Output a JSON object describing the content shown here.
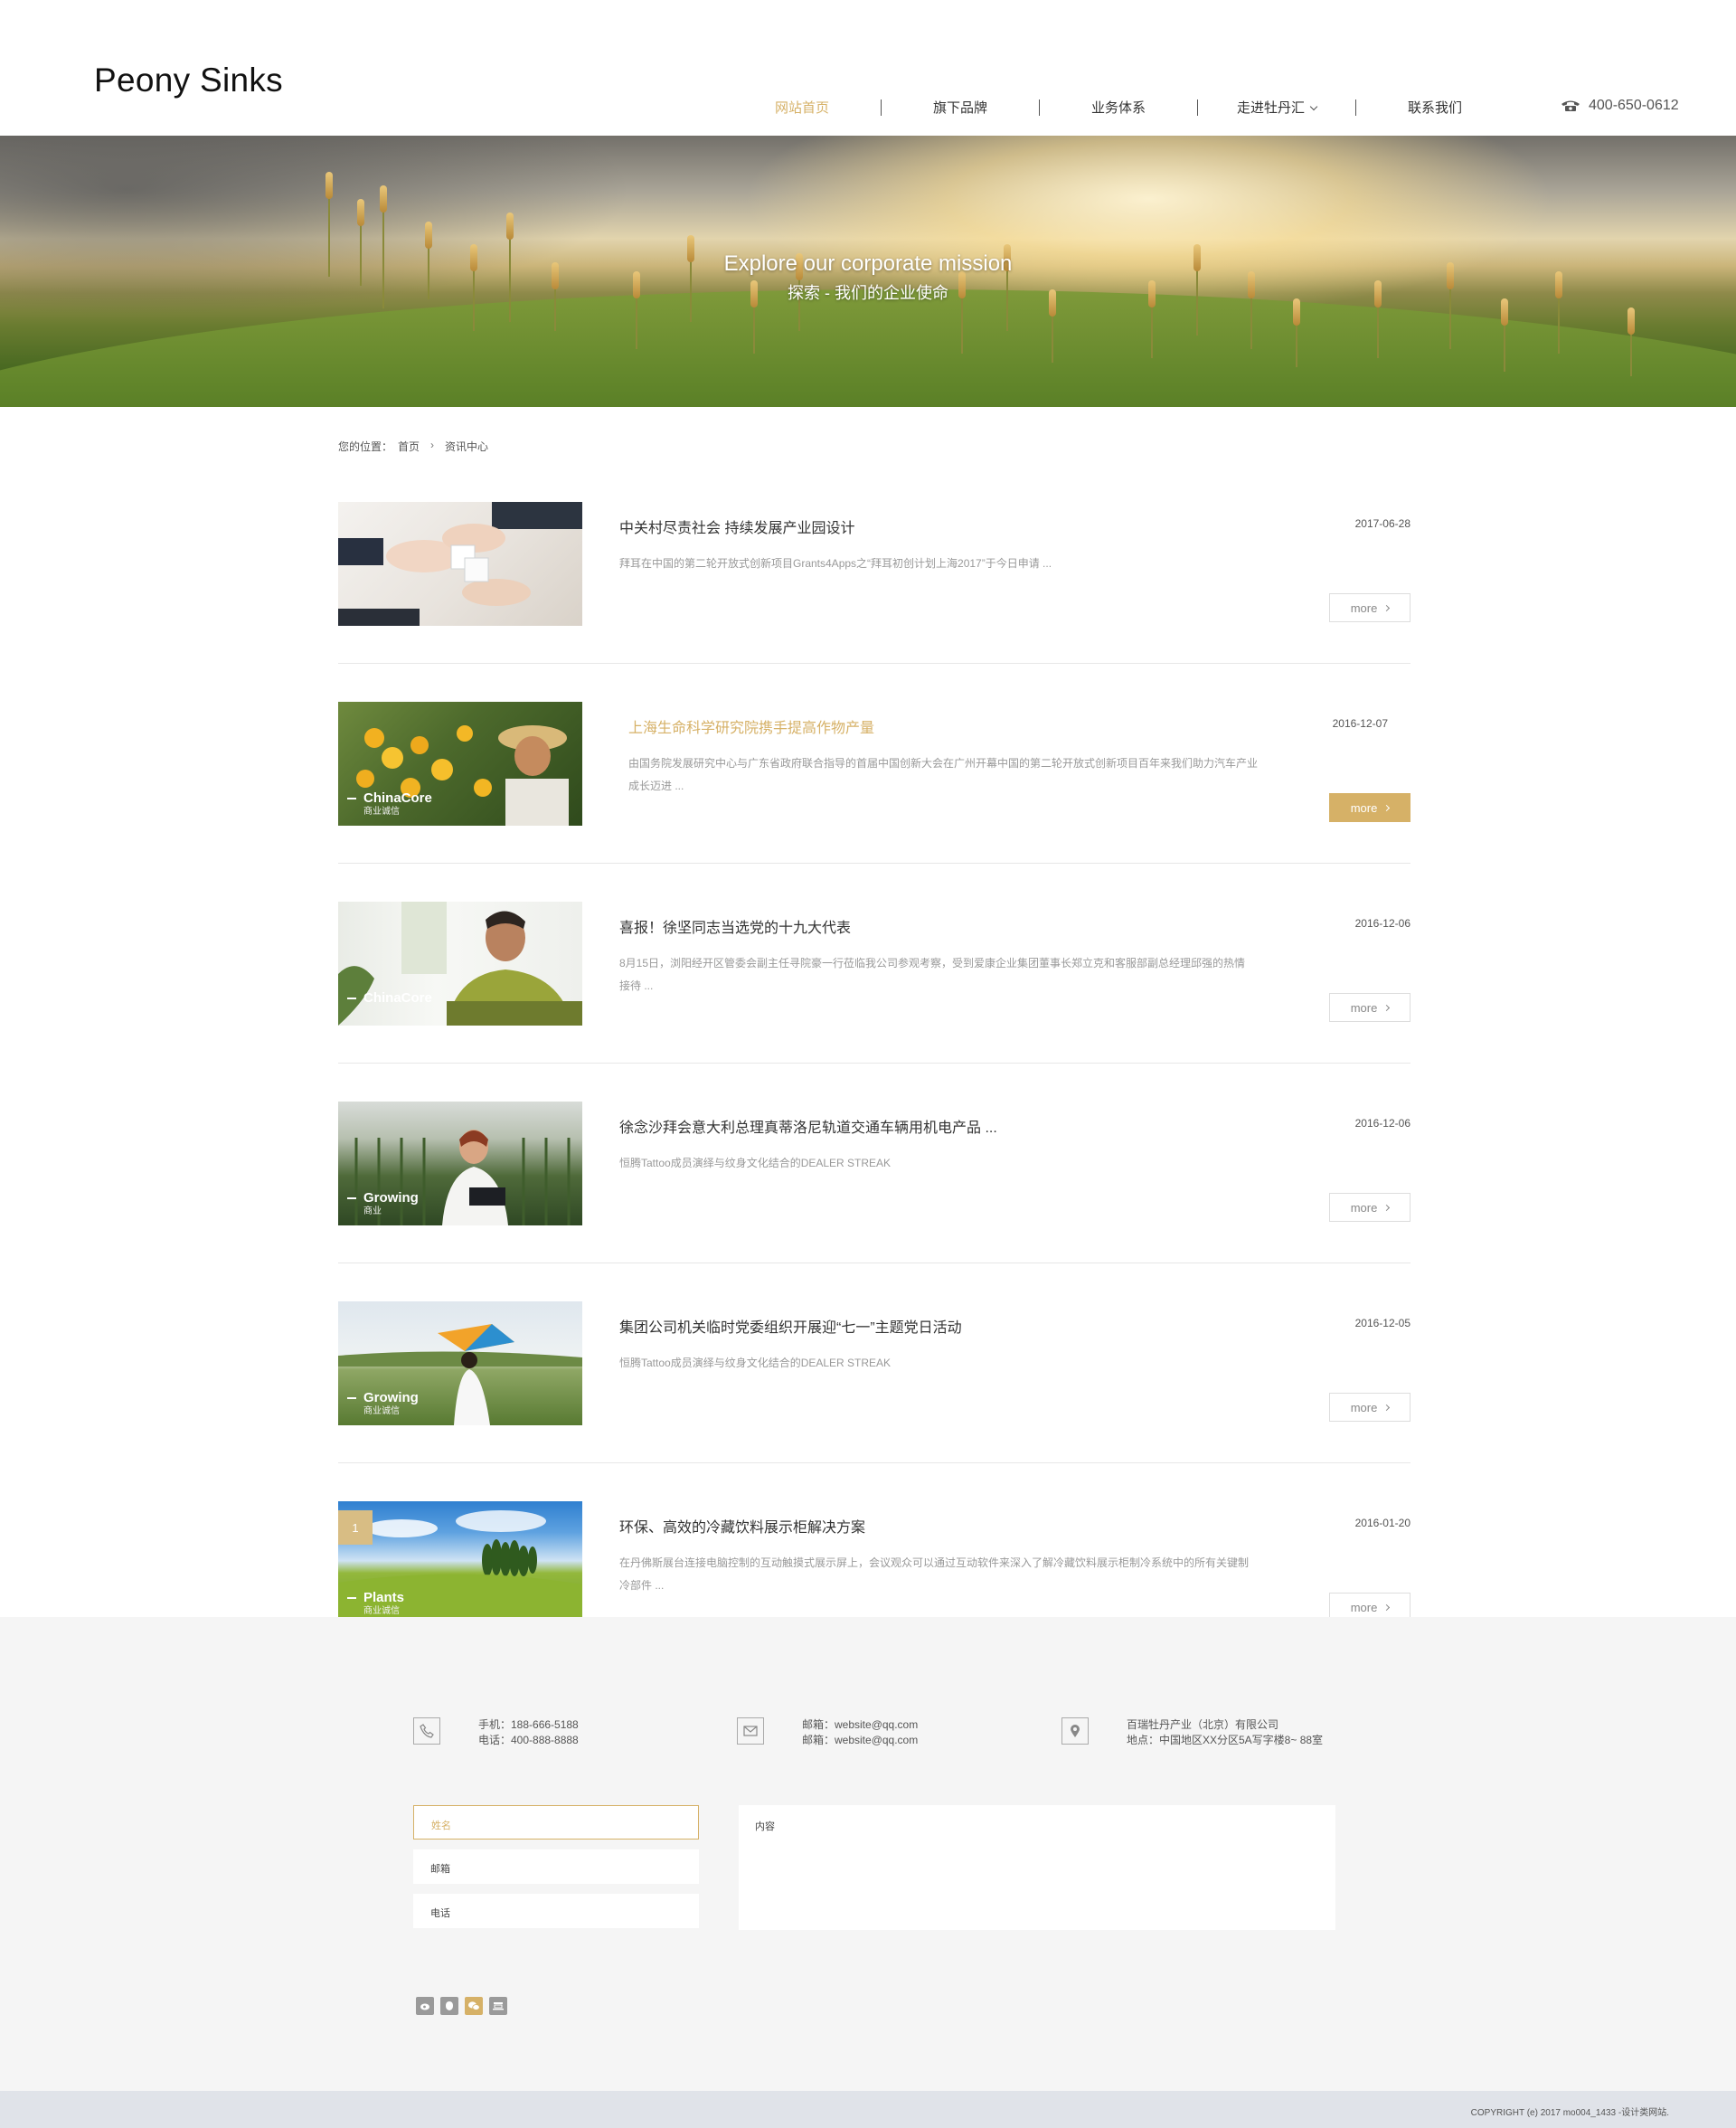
{
  "header": {
    "logo": "Peony Sinks",
    "nav": [
      "网站首页",
      "旗下品牌",
      "业务体系",
      "走进牡丹汇",
      "联系我们"
    ],
    "active_nav": "网站首页",
    "phone": "400-650-0612"
  },
  "banner": {
    "title": "Explore our corporate mission",
    "subtitle": "探索 - 我们的企业使命"
  },
  "breadcrumb": {
    "label": "您的位置：",
    "home": "首页",
    "current": "资讯中心"
  },
  "news": [
    {
      "title": "中关村尽责社会 持续发展产业园设计",
      "date": "2017-06-28",
      "desc": "拜耳在中国的第二轮开放式创新项目Grants4Apps之“拜耳初创计划上海2017”于今日申请 ...",
      "more": "more",
      "thumb_caption": "",
      "thumb_sub": "",
      "thumb_icon": "hands-puzzle-photo"
    },
    {
      "title": "上海生命科学研究院携手提高作物产量",
      "date": "2016-12-07",
      "desc": "由国务院发展研究中心与广东省政府联合指导的首届中国创新大会在广州开幕中国的第二轮开放式创新项目百年来我们助力汽车产业成长迈进 ...",
      "more": "more",
      "highlighted": true,
      "thumb_caption": "ChinaCore",
      "thumb_sub": "商业诚信",
      "thumb_icon": "orange-farmer-photo"
    },
    {
      "title": "喜报！徐坚同志当选党的十九大代表",
      "date": "2016-12-06",
      "desc": "8月15日，浏阳经开区管委会副主任寻院豪一行莅临我公司参观考察，受到爱康企业集团董事长郑立克和客服部副总经理邱强的热情接待 ...",
      "more": "more",
      "thumb_caption": "ChinaCore",
      "thumb_sub": "",
      "thumb_icon": "man-thinking-photo"
    },
    {
      "title": "徐念沙拜会意大利总理真蒂洛尼轨道交通车辆用机电产品 ...",
      "date": "2016-12-06",
      "desc": "恒腾Tattoo成员演绎与纹身文化结合的DEALER STREAK",
      "more": "more",
      "thumb_caption": "Growing",
      "thumb_sub": "商业",
      "thumb_icon": "greenhouse-woman-photo"
    },
    {
      "title": "集团公司机关临时党委组织开展迎“七一”主题党日活动",
      "date": "2016-12-05",
      "desc": "恒腾Tattoo成员演绎与纹身文化结合的DEALER STREAK",
      "more": "more",
      "thumb_caption": "Growing",
      "thumb_sub": "商业诚信",
      "thumb_icon": "kite-child-photo"
    },
    {
      "title": "环保、高效的冷藏饮料展示柜解决方案",
      "date": "2016-01-20",
      "desc": "在丹佛斯展台连接电脑控制的互动触摸式展示屏上，会议观众可以通过互动软件来深入了解冷藏饮料展示柜制冷系统中的所有关键制冷部件 ...",
      "more": "more",
      "thumb_caption": "Plants",
      "thumb_sub": "商业诚信",
      "thumb_icon": "field-trees-photo"
    }
  ],
  "pager": {
    "current": "1"
  },
  "footer": {
    "phone_lines": [
      "手机：188-666-5188",
      "电话：400-888-8888"
    ],
    "email_lines": [
      "邮箱：website@qq.com",
      "邮箱：website@qq.com"
    ],
    "address_lines": [
      "百瑞牡丹产业（北京）有限公司",
      "地点：中国地区XX分区5A写字楼8~ 88室"
    ],
    "form": {
      "name": "姓名",
      "email": "邮箱",
      "phone": "电话",
      "content": "内容"
    },
    "social_icons": [
      "weibo-icon",
      "qq-icon",
      "wechat-icon",
      "douban-icon"
    ],
    "copyright": "COPYRIGHT (e) 2017 mo004_1433 -设计类网站."
  },
  "colors": {
    "accent": "#d6b167",
    "footer_bg": "#f5f5f5",
    "copyright_bg": "#e0e3e9"
  }
}
